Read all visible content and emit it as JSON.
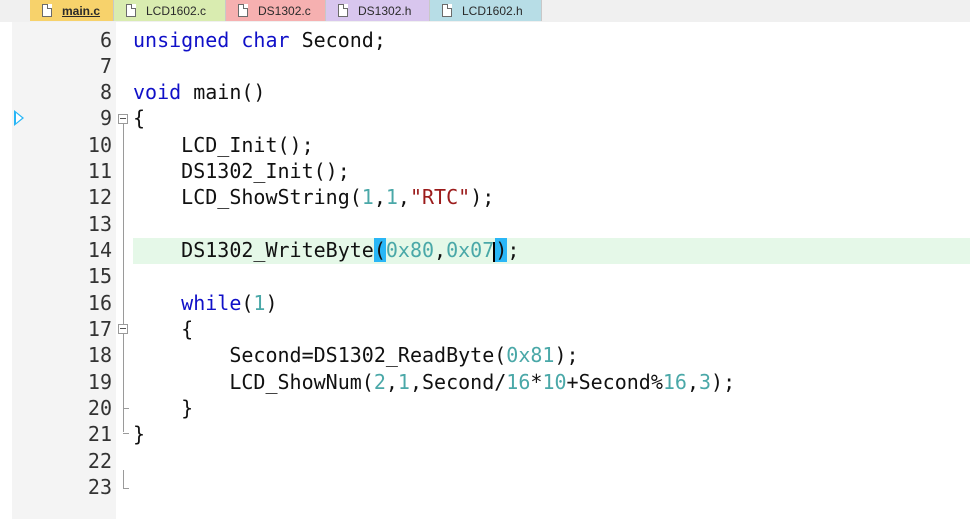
{
  "tabs": [
    {
      "label": "main.c",
      "bg": "#f7d26b",
      "active": true
    },
    {
      "label": "LCD1602.c",
      "bg": "#d9ecb0",
      "active": false
    },
    {
      "label": "DS1302.c",
      "bg": "#f6b0b0",
      "active": false
    },
    {
      "label": "DS1302.h",
      "bg": "#d8c6ee",
      "active": false
    },
    {
      "label": "LCD1602.h",
      "bg": "#b7dde6",
      "active": false
    }
  ],
  "editor": {
    "line_numbers": [
      "6",
      "7",
      "8",
      "9",
      "10",
      "11",
      "12",
      "13",
      "14",
      "15",
      "16",
      "17",
      "18",
      "19",
      "20",
      "21",
      "22",
      "23"
    ],
    "current_line": "14",
    "lines": {
      "l6": "unsigned char Second;",
      "l8_kw": "void",
      "l8_rest": " main()",
      "l9": "{",
      "l10": "    LCD_Init();",
      "l11": "    DS1302_Init();",
      "l12_a": "    LCD_ShowString(",
      "l12_n1": "1",
      "l12_c1": ",",
      "l12_n2": "1",
      "l12_c2": ",",
      "l12_s": "\"RTC\"",
      "l12_e": ");",
      "l14_a": "    DS1302_WriteByte",
      "l14_p1": "(",
      "l14_n1": "0x80",
      "l14_c": ",",
      "l14_n2": "0x07",
      "l14_p2": ")",
      "l14_e": ";",
      "l16_kw": "    while",
      "l16_p1": "(",
      "l16_n": "1",
      "l16_p2": ")",
      "l17": "    {",
      "l18_a": "        Second=DS1302_ReadByte(",
      "l18_n": "0x81",
      "l18_e": ");",
      "l19_a": "        LCD_ShowNum(",
      "l19_n1": "2",
      "l19_c1": ",",
      "l19_n2": "1",
      "l19_b": ",Second/",
      "l19_n3": "16",
      "l19_m": "*",
      "l19_n4": "10",
      "l19_p": "+Second%",
      "l19_n5": "16",
      "l19_c2": ",",
      "l19_n6": "3",
      "l19_e": ");",
      "l20": "    }",
      "l21": "}"
    }
  },
  "colors": {
    "keyword": "#1010c8",
    "number": "#4aa8a8",
    "string": "#9b1b1b",
    "current_line_bg": "#e5f8e8",
    "brace_match": "#29b6f6"
  }
}
